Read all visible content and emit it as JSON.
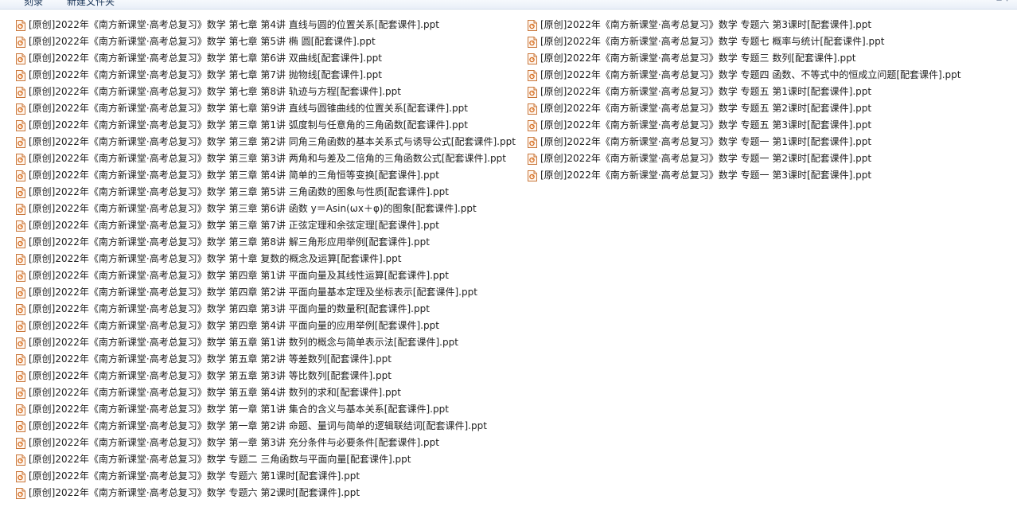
{
  "toolbar": {
    "left_label": "刻录",
    "right_label": "新建文件夹",
    "view_label": "≡ ▾"
  },
  "columns": [
    {
      "items": [
        "[原创]2022年《南方新课堂·高考总复习》数学 第七章 第4讲 直线与圆的位置关系[配套课件].ppt",
        "[原创]2022年《南方新课堂·高考总复习》数学 第七章 第5讲 椭 圆[配套课件].ppt",
        "[原创]2022年《南方新课堂·高考总复习》数学 第七章 第6讲 双曲线[配套课件].ppt",
        "[原创]2022年《南方新课堂·高考总复习》数学 第七章 第7讲 抛物线[配套课件].ppt",
        "[原创]2022年《南方新课堂·高考总复习》数学 第七章 第8讲 轨迹与方程[配套课件].ppt",
        "[原创]2022年《南方新课堂·高考总复习》数学 第七章 第9讲 直线与圆锥曲线的位置关系[配套课件].ppt",
        "[原创]2022年《南方新课堂·高考总复习》数学 第三章 第1讲 弧度制与任意角的三角函数[配套课件].ppt",
        "[原创]2022年《南方新课堂·高考总复习》数学 第三章 第2讲 同角三角函数的基本关系式与诱导公式[配套课件].ppt",
        "[原创]2022年《南方新课堂·高考总复习》数学 第三章 第3讲 两角和与差及二倍角的三角函数公式[配套课件].ppt",
        "[原创]2022年《南方新课堂·高考总复习》数学 第三章 第4讲 简单的三角恒等变换[配套课件].ppt",
        "[原创]2022年《南方新课堂·高考总复习》数学 第三章 第5讲 三角函数的图象与性质[配套课件].ppt",
        "[原创]2022年《南方新课堂·高考总复习》数学 第三章 第6讲 函数 y＝Asin(ωx＋φ)的图象[配套课件].ppt",
        "[原创]2022年《南方新课堂·高考总复习》数学 第三章 第7讲 正弦定理和余弦定理[配套课件].ppt",
        "[原创]2022年《南方新课堂·高考总复习》数学 第三章 第8讲 解三角形应用举例[配套课件].ppt",
        "[原创]2022年《南方新课堂·高考总复习》数学 第十章 复数的概念及运算[配套课件].ppt",
        "[原创]2022年《南方新课堂·高考总复习》数学 第四章 第1讲 平面向量及其线性运算[配套课件].ppt",
        "[原创]2022年《南方新课堂·高考总复习》数学 第四章 第2讲 平面向量基本定理及坐标表示[配套课件].ppt",
        "[原创]2022年《南方新课堂·高考总复习》数学 第四章 第3讲 平面向量的数量积[配套课件].ppt",
        "[原创]2022年《南方新课堂·高考总复习》数学 第四章 第4讲 平面向量的应用举例[配套课件].ppt",
        "[原创]2022年《南方新课堂·高考总复习》数学 第五章 第1讲 数列的概念与简单表示法[配套课件].ppt",
        "[原创]2022年《南方新课堂·高考总复习》数学 第五章 第2讲 等差数列[配套课件].ppt",
        "[原创]2022年《南方新课堂·高考总复习》数学 第五章 第3讲 等比数列[配套课件].ppt",
        "[原创]2022年《南方新课堂·高考总复习》数学 第五章 第4讲 数列的求和[配套课件].ppt",
        "[原创]2022年《南方新课堂·高考总复习》数学 第一章 第1讲 集合的含义与基本关系[配套课件].ppt",
        "[原创]2022年《南方新课堂·高考总复习》数学 第一章 第2讲 命题、量词与简单的逻辑联结词[配套课件].ppt",
        "[原创]2022年《南方新课堂·高考总复习》数学 第一章 第3讲 充分条件与必要条件[配套课件].ppt",
        "[原创]2022年《南方新课堂·高考总复习》数学 专题二 三角函数与平面向量[配套课件].ppt",
        "[原创]2022年《南方新课堂·高考总复习》数学 专题六 第1课时[配套课件].ppt",
        "[原创]2022年《南方新课堂·高考总复习》数学 专题六 第2课时[配套课件].ppt"
      ]
    },
    {
      "items": [
        "[原创]2022年《南方新课堂·高考总复习》数学 专题六 第3课时[配套课件].ppt",
        "[原创]2022年《南方新课堂·高考总复习》数学 专题七 概率与统计[配套课件].ppt",
        "[原创]2022年《南方新课堂·高考总复习》数学 专题三 数列[配套课件].ppt",
        "[原创]2022年《南方新课堂·高考总复习》数学 专题四 函数、不等式中的恒成立问题[配套课件].ppt",
        "[原创]2022年《南方新课堂·高考总复习》数学 专题五 第1课时[配套课件].ppt",
        "[原创]2022年《南方新课堂·高考总复习》数学 专题五 第2课时[配套课件].ppt",
        "[原创]2022年《南方新课堂·高考总复习》数学 专题五 第3课时[配套课件].ppt",
        "[原创]2022年《南方新课堂·高考总复习》数学 专题一 第1课时[配套课件].ppt",
        "[原创]2022年《南方新课堂·高考总复习》数学 专题一 第2课时[配套课件].ppt",
        "[原创]2022年《南方新课堂·高考总复习》数学 专题一 第3课时[配套课件].ppt"
      ]
    }
  ]
}
